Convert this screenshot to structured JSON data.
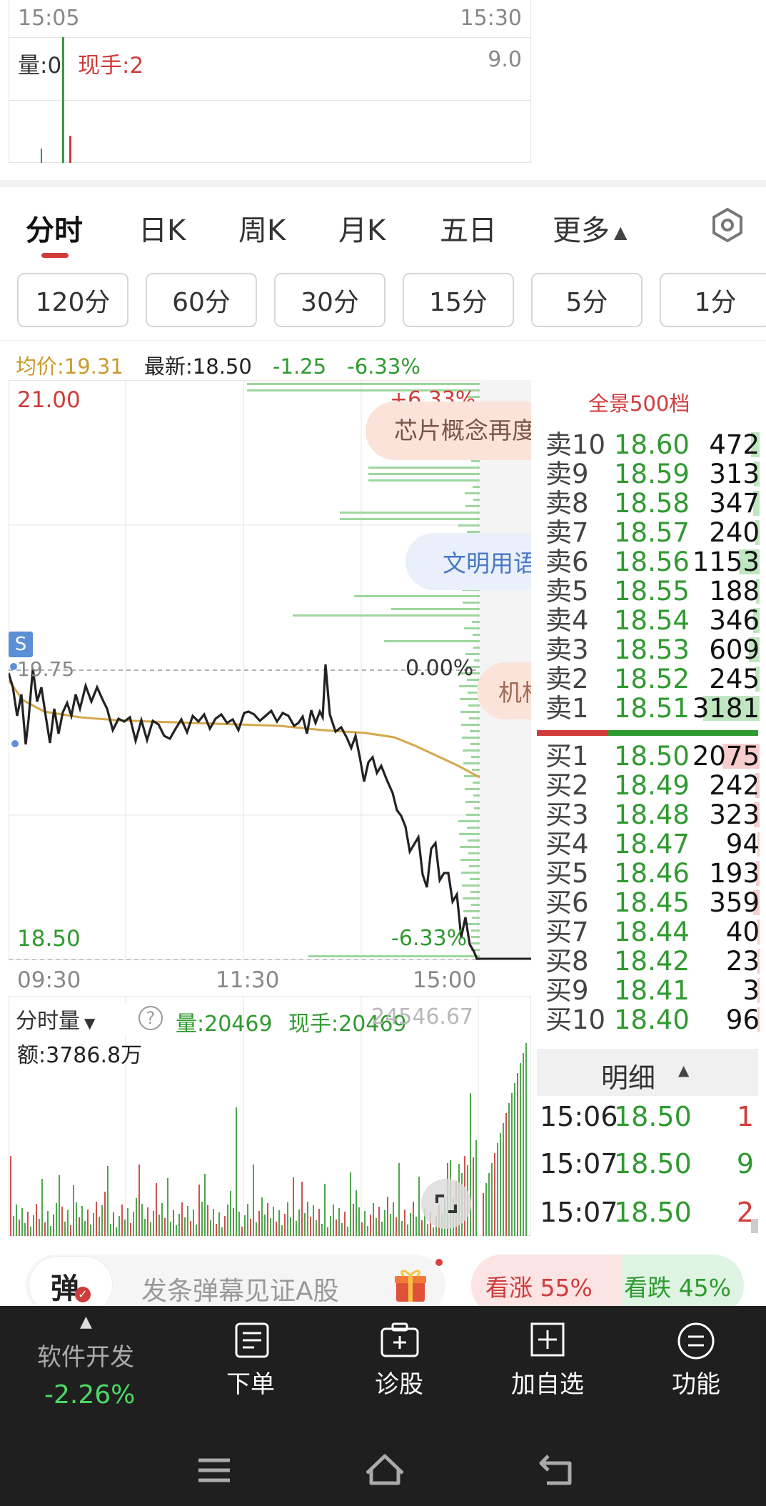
{
  "top_chart": {
    "time_start": "15:05",
    "time_end": "15:30",
    "vol_label": "量:0",
    "hand_label": "现手:2",
    "vol_max": "9.0"
  },
  "period_tabs": [
    {
      "label": "分时"
    },
    {
      "label": "日K"
    },
    {
      "label": "周K"
    },
    {
      "label": "月K"
    },
    {
      "label": "五日"
    },
    {
      "label": "更多"
    }
  ],
  "active_period": "分时",
  "interval_pills": [
    "120分",
    "60分",
    "30分",
    "15分",
    "5分",
    "1分"
  ],
  "info_bar": {
    "avg": "均价:19.31",
    "latest": "最新:18.50",
    "change": "-1.25",
    "pct": "-6.33%"
  },
  "chart": {
    "y_high": "21.00",
    "y_low": "18.50",
    "pct_high": "+6.33%",
    "pct_zero": "0.00%",
    "pct_low": "-6.33%",
    "base_price": "19.75",
    "marker": "S",
    "times": [
      "09:30",
      "11:30",
      "15:00"
    ],
    "bubble1": "芯片概念再度",
    "bubble2": "文明用语",
    "bubble3": "机构"
  },
  "volume_panel": {
    "label": "分时量",
    "vol": "量:20469",
    "hand": "现手:20469",
    "top_value": "24546.67",
    "amount": "额:3786.8万"
  },
  "order_book": {
    "title": "全景500档",
    "asks": [
      {
        "label": "卖10",
        "price": "18.60",
        "vol": "472",
        "bar": 0.12
      },
      {
        "label": "卖9",
        "price": "18.59",
        "vol": "313",
        "bar": 0.08
      },
      {
        "label": "卖8",
        "price": "18.58",
        "vol": "347",
        "bar": 0.09
      },
      {
        "label": "卖7",
        "price": "18.57",
        "vol": "240",
        "bar": 0.06
      },
      {
        "label": "卖6",
        "price": "18.56",
        "vol": "1153",
        "bar": 0.3
      },
      {
        "label": "卖5",
        "price": "18.55",
        "vol": "188",
        "bar": 0.05
      },
      {
        "label": "卖4",
        "price": "18.54",
        "vol": "346",
        "bar": 0.09
      },
      {
        "label": "卖3",
        "price": "18.53",
        "vol": "609",
        "bar": 0.16
      },
      {
        "label": "卖2",
        "price": "18.52",
        "vol": "245",
        "bar": 0.06
      },
      {
        "label": "卖1",
        "price": "18.51",
        "vol": "3181",
        "bar": 0.82
      }
    ],
    "bids": [
      {
        "label": "买1",
        "price": "18.50",
        "vol": "2075",
        "bar": 0.54
      },
      {
        "label": "买2",
        "price": "18.49",
        "vol": "242",
        "bar": 0.06
      },
      {
        "label": "买3",
        "price": "18.48",
        "vol": "323",
        "bar": 0.08
      },
      {
        "label": "买4",
        "price": "18.47",
        "vol": "94",
        "bar": 0.03
      },
      {
        "label": "买5",
        "price": "18.46",
        "vol": "193",
        "bar": 0.05
      },
      {
        "label": "买6",
        "price": "18.45",
        "vol": "359",
        "bar": 0.09
      },
      {
        "label": "买7",
        "price": "18.44",
        "vol": "40",
        "bar": 0.01
      },
      {
        "label": "买8",
        "price": "18.42",
        "vol": "23",
        "bar": 0.01
      },
      {
        "label": "买9",
        "price": "18.41",
        "vol": "3",
        "bar": 0.005
      },
      {
        "label": "买10",
        "price": "18.40",
        "vol": "96",
        "bar": 0.03
      }
    ]
  },
  "detail": {
    "title": "明细",
    "rows": [
      {
        "time": "15:06",
        "price": "18.50",
        "vol": "1",
        "dir": "buy"
      },
      {
        "time": "15:07",
        "price": "18.50",
        "vol": "9",
        "dir": "sell"
      },
      {
        "time": "15:07",
        "price": "18.50",
        "vol": "2",
        "dir": "buy"
      }
    ]
  },
  "danmu": {
    "button": "弹",
    "placeholder": "发条弹幕见证A股"
  },
  "vote": {
    "up": "看涨 55%",
    "down": "看跌 45%",
    "up_ratio": 0.55
  },
  "bottom_bar": {
    "sector_name": "软件开发",
    "sector_change": "-2.26%",
    "items": [
      {
        "label": "下单",
        "icon": "order-icon"
      },
      {
        "label": "诊股",
        "icon": "diagnose-icon"
      },
      {
        "label": "加自选",
        "icon": "add-watchlist-icon"
      },
      {
        "label": "功能",
        "icon": "menu-icon"
      }
    ]
  },
  "colors": {
    "up": "#d03b3b",
    "down": "#2f9a2f",
    "avg_line": "#d4a84a",
    "price_line": "#222222",
    "nav_bg": "#1f1f1f"
  }
}
